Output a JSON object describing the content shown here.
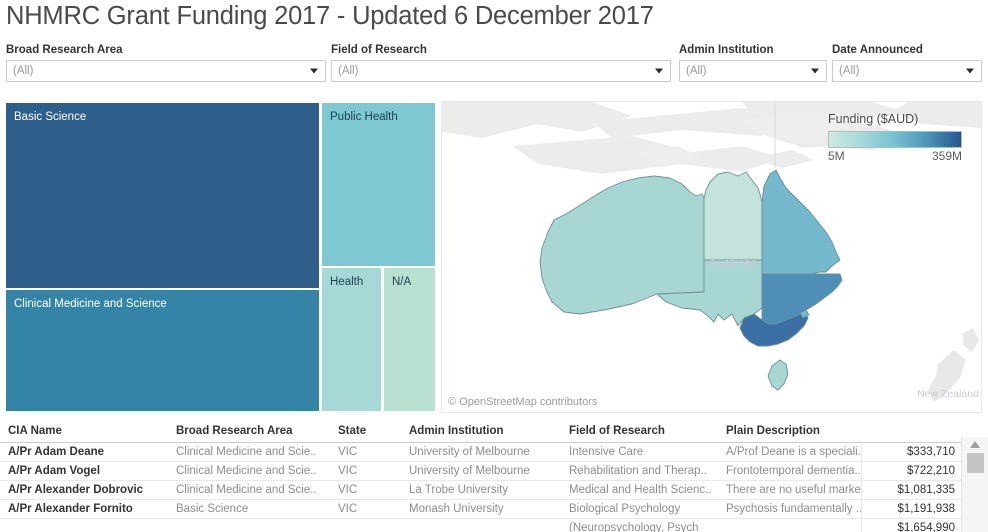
{
  "header": {
    "title": "NHMRC Grant Funding 2017 - Updated 6 December 2017"
  },
  "filters": [
    {
      "name": "broad-research-area",
      "label": "Broad Research Area",
      "value": "(All)"
    },
    {
      "name": "field-of-research",
      "label": "Field of Research",
      "value": "(All)"
    },
    {
      "name": "admin-institution",
      "label": "Admin Institution",
      "value": "(All)"
    },
    {
      "name": "date-announced",
      "label": "Date Announced",
      "value": "(All)"
    }
  ],
  "treemap": {
    "tiles": [
      {
        "label": "Basic Science",
        "color": "#2e5f8a",
        "text": "light"
      },
      {
        "label": "Clinical Medicine and Science",
        "color": "#3484a8",
        "text": "light"
      },
      {
        "label": "Public Health",
        "color": "#7ec8d2",
        "text": "dark"
      },
      {
        "label": "Health",
        "color": "#a6d8d5",
        "text": "dark"
      },
      {
        "label": "N/A",
        "color": "#b9e0d1",
        "text": "dark"
      }
    ]
  },
  "map": {
    "credit": "© OpenStreetMap contributors",
    "places": [
      {
        "name": "Australia"
      },
      {
        "name": "New Zealand"
      }
    ],
    "legend": {
      "title": "Funding ($AUD)",
      "min_label": "5M",
      "max_label": "359M",
      "gradient_start": "#cfeae3",
      "gradient_end": "#22578e"
    },
    "regions": [
      {
        "name": "western-australia",
        "fill": "#a8d7d3"
      },
      {
        "name": "northern-territory",
        "fill": "#c3e3dc"
      },
      {
        "name": "south-australia",
        "fill": "#a8d7d3"
      },
      {
        "name": "queensland",
        "fill": "#74b9cd"
      },
      {
        "name": "new-south-wales",
        "fill": "#4f8fb7"
      },
      {
        "name": "victoria",
        "fill": "#3c6fa3"
      },
      {
        "name": "tasmania",
        "fill": "#a8d7d3"
      },
      {
        "name": "australian-capital-territory",
        "fill": "#74b9cd"
      }
    ]
  },
  "table": {
    "columns": [
      "CIA Name",
      "Broad Research Area",
      "State",
      "Admin Institution",
      "Field of Research",
      "Plain Description",
      ""
    ],
    "rows": [
      {
        "cia_name": "A/Pr Adam Deane",
        "broad_research_area": "Clinical Medicine and Scie..",
        "state": "VIC",
        "admin_institution": "University of Melbourne",
        "field_of_research": "Intensive Care",
        "plain_description": "A/Prof Deane is a speciali..",
        "amount": "$333,710"
      },
      {
        "cia_name": "A/Pr Adam Vogel",
        "broad_research_area": "Clinical Medicine and Scie..",
        "state": "VIC",
        "admin_institution": "University of Melbourne",
        "field_of_research": "Rehabilitation and Therap..",
        "plain_description": "Frontotemporal dementia..",
        "amount": "$722,210"
      },
      {
        "cia_name": "A/Pr Alexander Dobrovic",
        "broad_research_area": "Clinical Medicine and Scie..",
        "state": "VIC",
        "admin_institution": "La Trobe University",
        "field_of_research": "Medical and Health Scienc..",
        "plain_description": "There are no useful marke..",
        "amount": "$1,081,335"
      },
      {
        "cia_name": "A/Pr Alexander Fornito",
        "broad_research_area": "Basic Science",
        "state": "VIC",
        "admin_institution": "Monash University",
        "field_of_research": "Biological Psychology",
        "plain_description": "Psychosis fundamentally ..",
        "amount": "$1,191,938"
      },
      {
        "cia_name": "",
        "broad_research_area": "",
        "state": "",
        "admin_institution": "",
        "field_of_research": "(Neuropsychology, Psych",
        "plain_description": "",
        "amount": "$1,654,990"
      }
    ]
  },
  "scrollbar": {
    "name": "table-vertical-scrollbar"
  }
}
